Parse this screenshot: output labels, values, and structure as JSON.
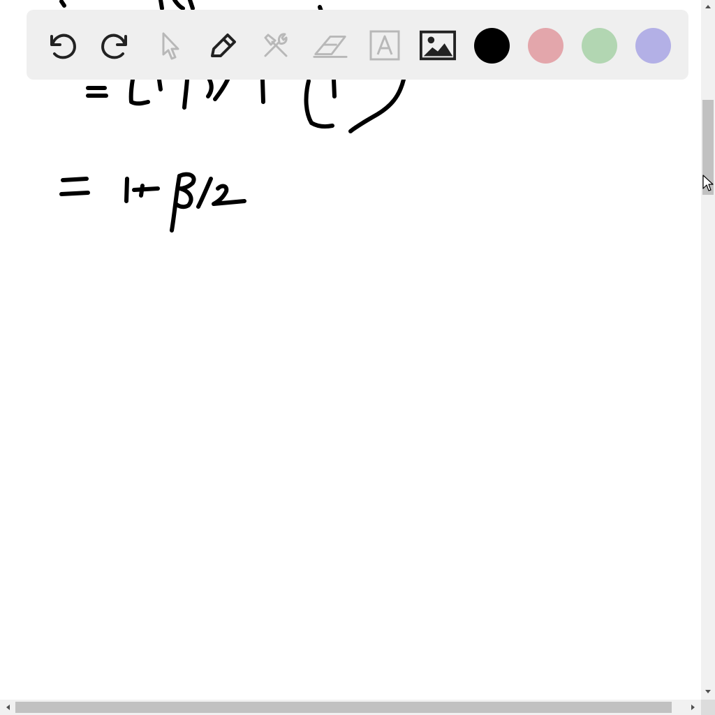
{
  "canvas": {
    "background": "#ffffff",
    "ink_color": "#000000"
  },
  "toolbar": {
    "background": "#efefef",
    "tools": [
      {
        "name": "undo",
        "icon": "undo-icon",
        "enabled": true
      },
      {
        "name": "redo",
        "icon": "redo-icon",
        "enabled": true
      },
      {
        "name": "select",
        "icon": "pointer-icon",
        "enabled": false
      },
      {
        "name": "pen",
        "icon": "pen-icon",
        "enabled": true
      },
      {
        "name": "tools",
        "icon": "tools-icon",
        "enabled": false
      },
      {
        "name": "eraser",
        "icon": "eraser-icon",
        "enabled": false
      },
      {
        "name": "text",
        "icon": "text-icon",
        "enabled": false
      },
      {
        "name": "image",
        "icon": "image-icon",
        "enabled": true
      }
    ],
    "colors": [
      {
        "name": "black",
        "hex": "#000000"
      },
      {
        "name": "red",
        "hex": "#e3a6ab"
      },
      {
        "name": "green",
        "hex": "#b2d6b2"
      },
      {
        "name": "blue",
        "hex": "#b3b0e6"
      }
    ]
  },
  "scrollbars": {
    "vertical": {
      "position": 0.14
    },
    "horizontal": {
      "position": 0.0
    }
  }
}
